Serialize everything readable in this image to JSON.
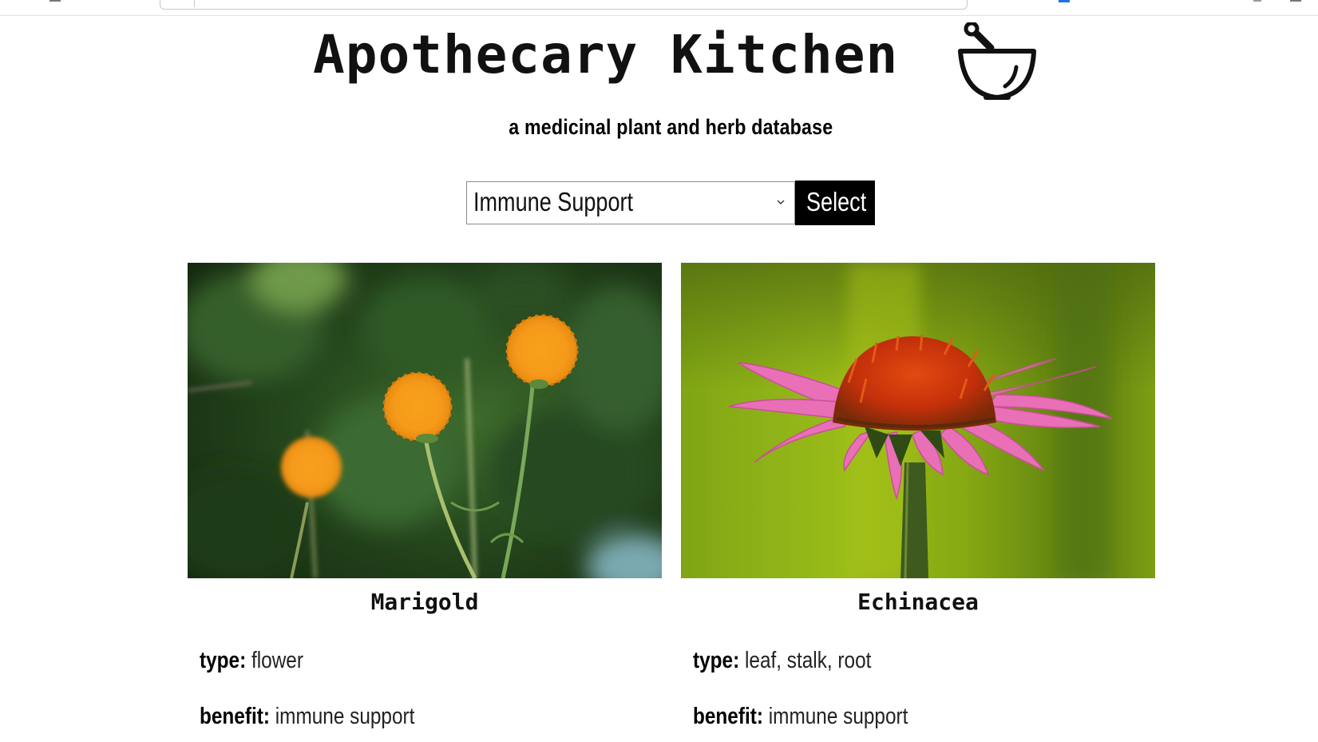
{
  "header": {
    "title": "Apothecary Kitchen",
    "subtitle": "a medicinal plant and herb database",
    "logo_icon": "mortar-and-pestle-icon"
  },
  "filter": {
    "selected": "Immune Support",
    "button_label": "Select"
  },
  "plants": [
    {
      "name": "Marigold",
      "type_label": "type:",
      "type_value": "flower",
      "benefit_label": "benefit:",
      "benefit_value": "immune support"
    },
    {
      "name": "Echinacea",
      "type_label": "type:",
      "type_value": "leaf, stalk, root",
      "benefit_label": "benefit:",
      "benefit_value": "immune support"
    }
  ],
  "colors": {
    "button_bg": "#000000",
    "button_text": "#ffffff",
    "marigold_orange": "#f59a1a",
    "echinacea_pink": "#e96fb6",
    "echinacea_bg": "#8fb317"
  }
}
